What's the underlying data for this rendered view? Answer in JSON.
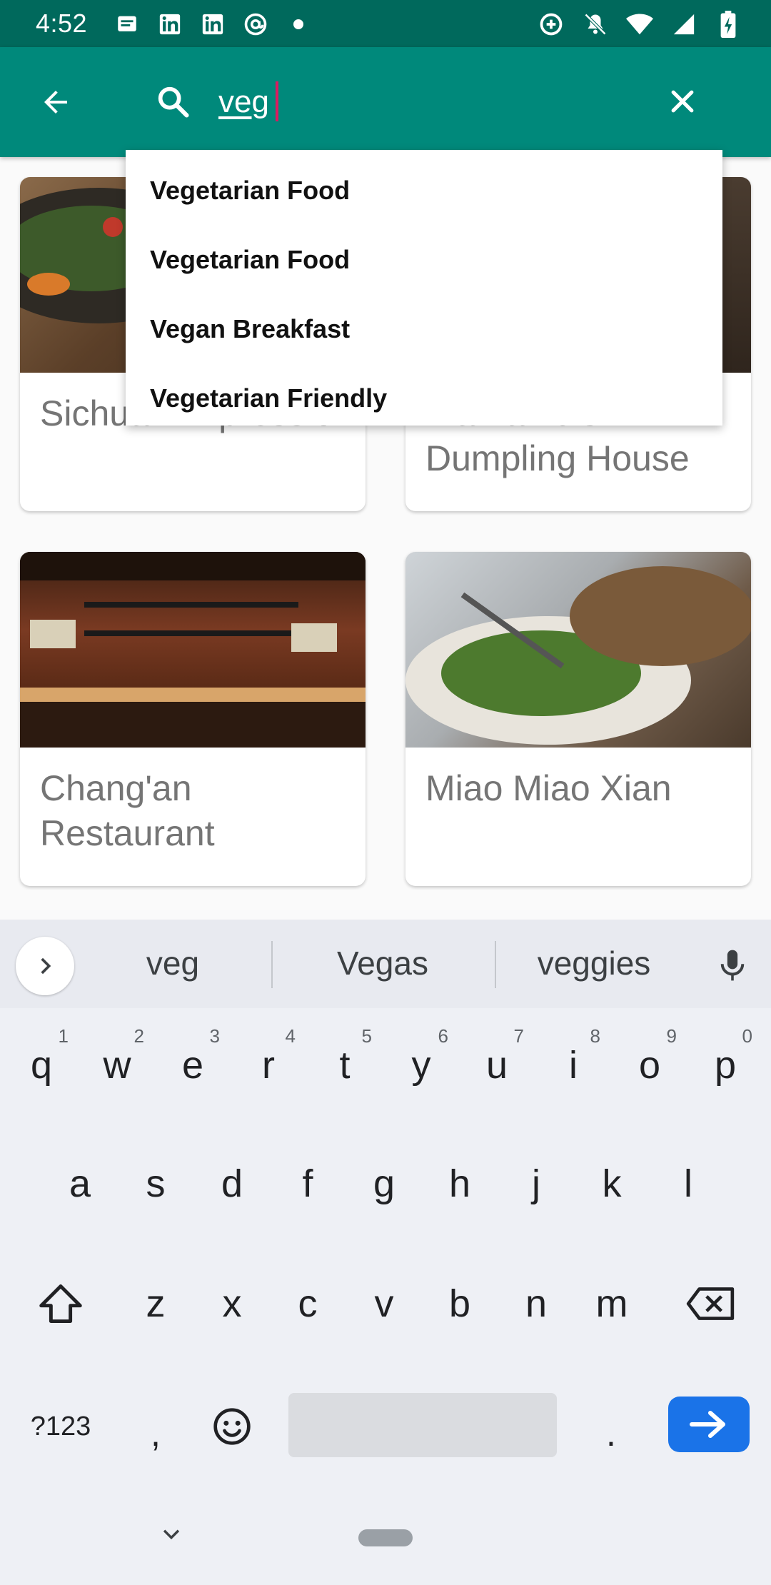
{
  "status_bar": {
    "time": "4:52",
    "left_icons": [
      "message-icon",
      "linkedin-icon",
      "linkedin-icon",
      "at-sign-icon",
      "dot-icon"
    ],
    "right_icons": [
      "data-saver-icon",
      "notifications-off-icon",
      "wifi-icon",
      "signal-icon",
      "battery-charging-icon"
    ]
  },
  "search": {
    "query": "veg",
    "placeholder": ""
  },
  "suggestions": [
    "Vegetarian Food",
    "Vegetarian Food",
    "Vegan Breakfast",
    "Vegetarian Friendly"
  ],
  "restaurants": [
    {
      "name": "Sichuan Impression"
    },
    {
      "name": "Mama Lu's Dumpling House"
    },
    {
      "name": "Chang'an Restaurant"
    },
    {
      "name": "Miao Miao Xian"
    }
  ],
  "keyboard": {
    "word_suggestions": [
      "veg",
      "Vegas",
      "veggies"
    ],
    "row1": [
      {
        "key": "q",
        "hint": "1"
      },
      {
        "key": "w",
        "hint": "2"
      },
      {
        "key": "e",
        "hint": "3"
      },
      {
        "key": "r",
        "hint": "4"
      },
      {
        "key": "t",
        "hint": "5"
      },
      {
        "key": "y",
        "hint": "6"
      },
      {
        "key": "u",
        "hint": "7"
      },
      {
        "key": "i",
        "hint": "8"
      },
      {
        "key": "o",
        "hint": "9"
      },
      {
        "key": "p",
        "hint": "0"
      }
    ],
    "row2": [
      "a",
      "s",
      "d",
      "f",
      "g",
      "h",
      "j",
      "k",
      "l"
    ],
    "row3": [
      "z",
      "x",
      "c",
      "v",
      "b",
      "n",
      "m"
    ],
    "symbols_label": "?123",
    "comma": ",",
    "period": "."
  },
  "colors": {
    "status_bar": "#00695c",
    "app_bar": "#00897b",
    "cursor": "#d81b60",
    "enter_key": "#1a73e8"
  }
}
